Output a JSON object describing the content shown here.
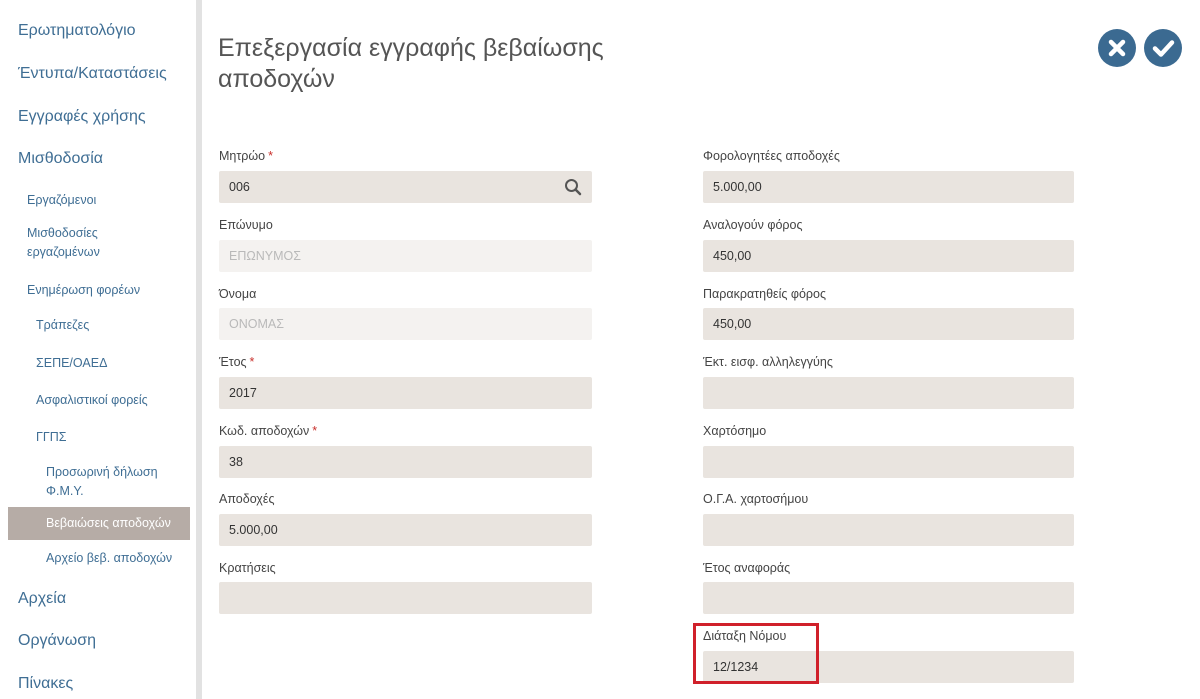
{
  "sidebar": {
    "items": [
      {
        "label": "Ερωτηματολόγιο",
        "level": 0
      },
      {
        "label": "Έντυπα/Καταστάσεις",
        "level": 0
      },
      {
        "label": "Εγγραφές χρήσης",
        "level": 0
      },
      {
        "label": "Μισθοδοσία",
        "level": 0
      },
      {
        "label": "Εργαζόμενοι",
        "level": 1
      },
      {
        "label": "Μισθοδοσίες εργαζομένων",
        "level": 1
      },
      {
        "label": "Ενημέρωση φορέων",
        "level": 1
      },
      {
        "label": "Τράπεζες",
        "level": 2
      },
      {
        "label": "ΣΕΠΕ/ΟΑΕΔ",
        "level": 2
      },
      {
        "label": "Ασφαλιστικοί φορείς",
        "level": 2
      },
      {
        "label": "ΓΓΠΣ",
        "level": 2
      },
      {
        "label": "Προσωρινή δήλωση Φ.Μ.Υ.",
        "level": 3
      },
      {
        "label": "Βεβαιώσεις αποδοχών",
        "level": 3,
        "active": true
      },
      {
        "label": "Αρχείο βεβ. αποδοχών",
        "level": 3
      },
      {
        "label": "Αρχεία",
        "level": 0
      },
      {
        "label": "Οργάνωση",
        "level": 0
      },
      {
        "label": "Πίνακες",
        "level": 0
      }
    ]
  },
  "header": {
    "title": "Επεξεργασία εγγραφής βεβαίωσης αποδοχών",
    "cancel_icon": "close-icon",
    "save_icon": "check-icon"
  },
  "form": {
    "left": [
      {
        "label": "Μητρώο",
        "required": true,
        "value": "006",
        "icon": "search-icon"
      },
      {
        "label": "Επώνυμο",
        "required": false,
        "value": "ΕΠΩΝΥΜΟΣ",
        "disabled": true
      },
      {
        "label": "Όνομα",
        "required": false,
        "value": "ΟΝΟΜΑΣ",
        "disabled": true
      },
      {
        "label": "Έτος",
        "required": true,
        "value": "2017"
      },
      {
        "label": "Κωδ. αποδοχών",
        "required": true,
        "value": "38"
      },
      {
        "label": "Αποδοχές",
        "required": false,
        "value": "5.000,00"
      },
      {
        "label": "Κρατήσεις",
        "required": false,
        "value": ""
      }
    ],
    "right": [
      {
        "label": "Φορολογητέες αποδοχές",
        "value": "5.000,00"
      },
      {
        "label": "Αναλογούν φόρος",
        "value": "450,00"
      },
      {
        "label": "Παρακρατηθείς φόρος",
        "value": "450,00"
      },
      {
        "label": "Έκτ. εισφ. αλληλεγγύης",
        "value": ""
      },
      {
        "label": "Χαρτόσημο",
        "value": ""
      },
      {
        "label": "Ο.Γ.Α. χαρτοσήμου",
        "value": ""
      },
      {
        "label": "Έτος αναφοράς",
        "value": ""
      },
      {
        "label": "Διάταξη Νόμου",
        "value": "12/1234"
      }
    ]
  },
  "colors": {
    "accent": "#3b6a91",
    "link": "#3f6e94",
    "active_nav": "#b6aca6",
    "input_bg": "#e9e4df",
    "required": "#c9302c",
    "highlight": "#d0202a"
  }
}
